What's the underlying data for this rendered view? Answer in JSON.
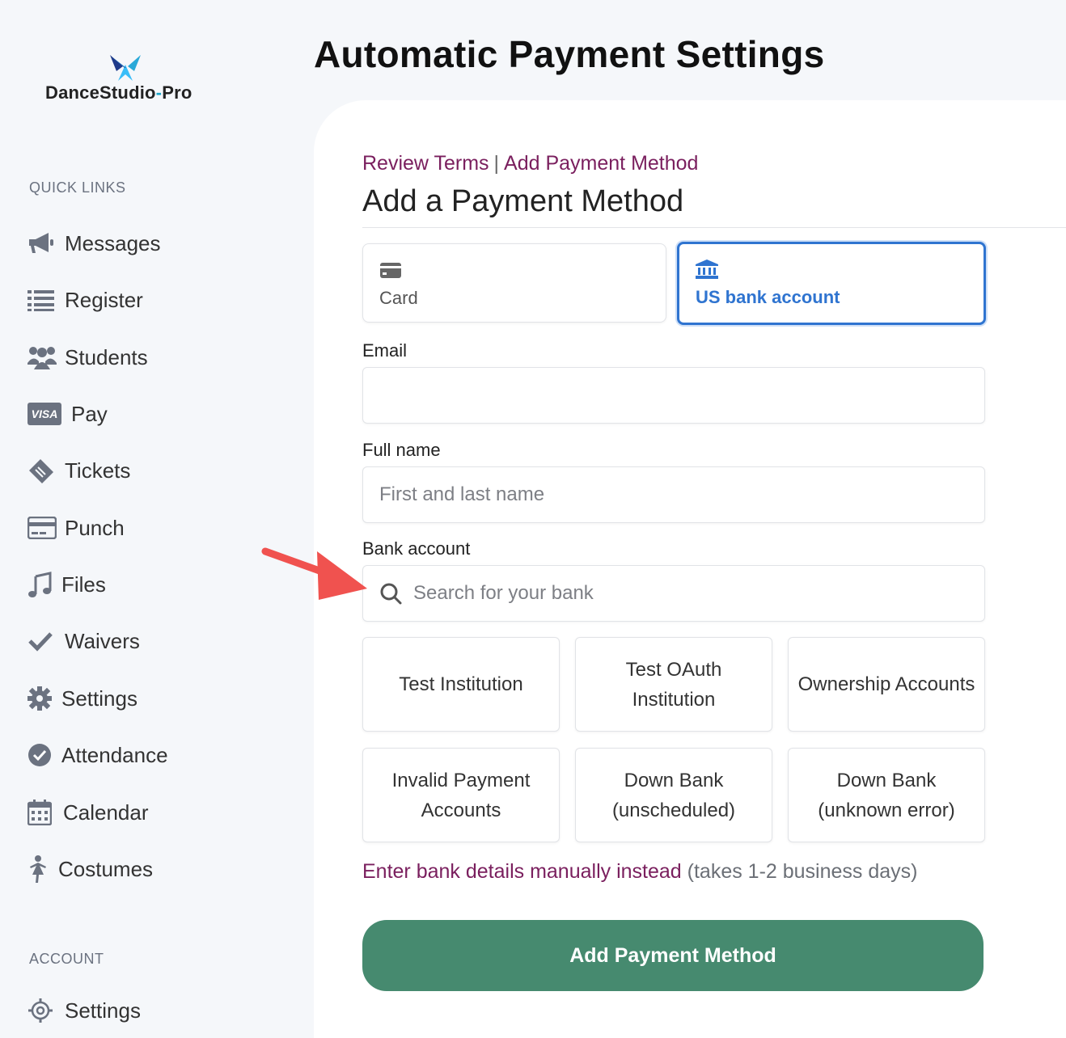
{
  "brand": {
    "name_part1": "DanceStudio",
    "name_dash": "-",
    "name_part2": "Pro"
  },
  "page_title": "Automatic Payment Settings",
  "sidebar": {
    "quick_links_heading": "QUICK LINKS",
    "items": [
      {
        "label": "Messages",
        "icon": "megaphone-icon"
      },
      {
        "label": "Register",
        "icon": "list-icon"
      },
      {
        "label": "Students",
        "icon": "users-icon"
      },
      {
        "label": "Pay",
        "icon": "visa-card-icon"
      },
      {
        "label": "Tickets",
        "icon": "ticket-icon"
      },
      {
        "label": "Punch",
        "icon": "credit-card-icon"
      },
      {
        "label": "Files",
        "icon": "music-note-icon"
      },
      {
        "label": "Waivers",
        "icon": "checkmark-icon"
      },
      {
        "label": "Settings",
        "icon": "gear-icon"
      },
      {
        "label": "Attendance",
        "icon": "check-circle-icon"
      },
      {
        "label": "Calendar",
        "icon": "calendar-icon"
      },
      {
        "label": "Costumes",
        "icon": "dancer-icon"
      }
    ],
    "account_heading": "ACCOUNT",
    "account_items": [
      {
        "label": "Settings",
        "icon": "gear-outline-icon"
      }
    ]
  },
  "breadcrumb": {
    "step1": "Review Terms",
    "separator": "|",
    "step2": "Add Payment Method"
  },
  "form": {
    "title": "Add a Payment Method",
    "tabs": [
      {
        "label": "Card",
        "icon": "card-icon",
        "active": false
      },
      {
        "label": "US bank account",
        "icon": "bank-icon",
        "active": true
      }
    ],
    "email_label": "Email",
    "email_value": "",
    "fullname_label": "Full name",
    "fullname_placeholder": "First and last name",
    "bank_label": "Bank account",
    "bank_search_placeholder": "Search for your bank",
    "banks": [
      "Test Institution",
      "Test OAuth Institution",
      "Ownership Accounts",
      "Invalid Payment Accounts",
      "Down Bank (unscheduled)",
      "Down Bank (unknown error)"
    ],
    "manual_link": "Enter bank details manually instead",
    "manual_note": "(takes 1-2 business days)",
    "submit_label": "Add Payment Method"
  },
  "colors": {
    "accent_purple": "#7a1f5e",
    "active_blue": "#2f74d0",
    "submit_green": "#468a6f",
    "annotation_arrow": "#f0524f"
  }
}
